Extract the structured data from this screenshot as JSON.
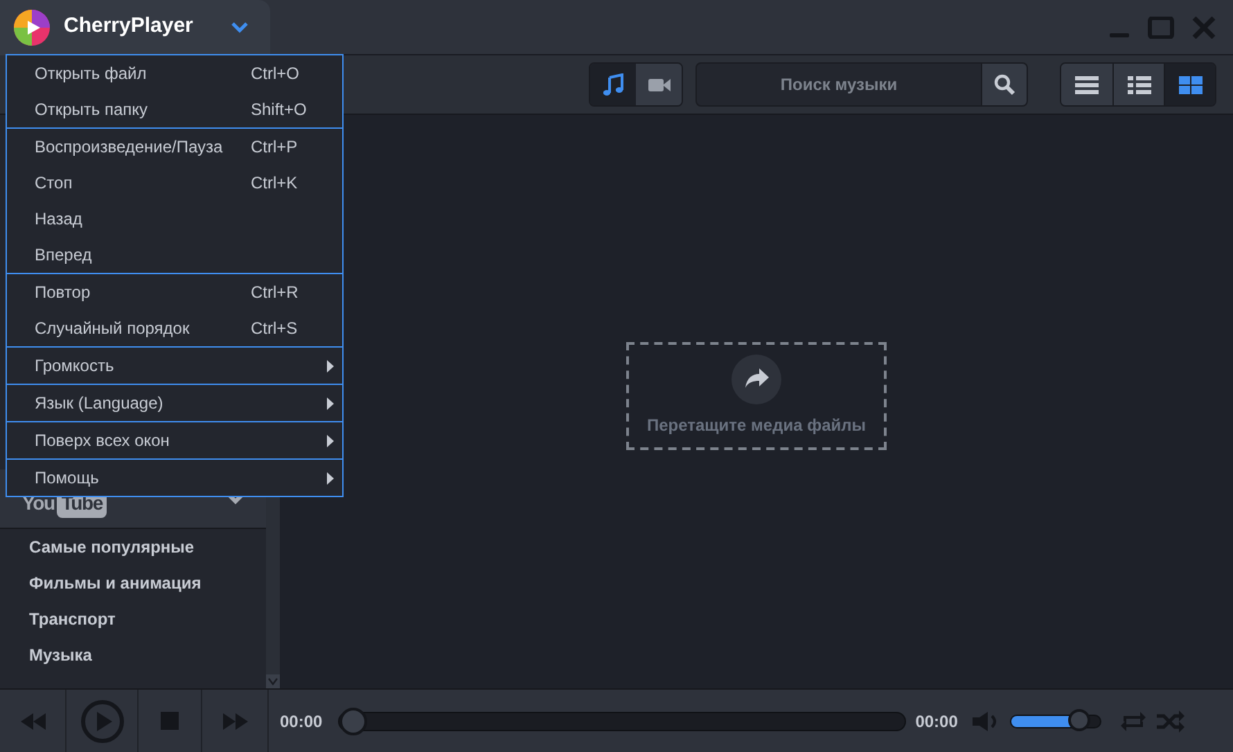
{
  "app": {
    "title": "CherryPlayer"
  },
  "media_toggle": [
    {
      "kind": "music",
      "selected": true
    },
    {
      "kind": "video",
      "selected": false
    }
  ],
  "search": {
    "placeholder": "Поиск музыки"
  },
  "view_modes": [
    {
      "kind": "rows",
      "selected": false
    },
    {
      "kind": "list",
      "selected": false
    },
    {
      "kind": "grid",
      "selected": true
    }
  ],
  "drop_zone": {
    "label": "Перетащите медиа файлы"
  },
  "sidebar": {
    "section": {
      "logo_left": "You",
      "logo_right": "Tube",
      "expanded": true
    },
    "items": [
      "Самые популярные",
      "Фильмы и анимация",
      "Транспорт",
      "Музыка"
    ]
  },
  "menu": {
    "groups": [
      [
        {
          "label": "Открыть файл",
          "shortcut": "Ctrl+O"
        },
        {
          "label": "Открыть папку",
          "shortcut": "Shift+O"
        }
      ],
      [
        {
          "label": "Воспроизведение/Пауза",
          "shortcut": "Ctrl+P"
        },
        {
          "label": "Стоп",
          "shortcut": "Ctrl+K"
        },
        {
          "label": "Назад"
        },
        {
          "label": "Вперед"
        }
      ],
      [
        {
          "label": "Повтор",
          "shortcut": "Ctrl+R"
        },
        {
          "label": "Случайный порядок",
          "shortcut": "Ctrl+S"
        }
      ],
      [
        {
          "label": "Громкость",
          "submenu": true
        }
      ],
      [
        {
          "label": "Язык (Language)",
          "submenu": true
        }
      ],
      [
        {
          "label": "Поверх всех окон",
          "submenu": true
        }
      ],
      [
        {
          "label": "Помощь",
          "submenu": true
        }
      ]
    ]
  },
  "player": {
    "elapsed": "00:00",
    "total": "00:00",
    "progress": {
      "level": 0
    },
    "volume": {
      "level": 0.85
    }
  }
}
